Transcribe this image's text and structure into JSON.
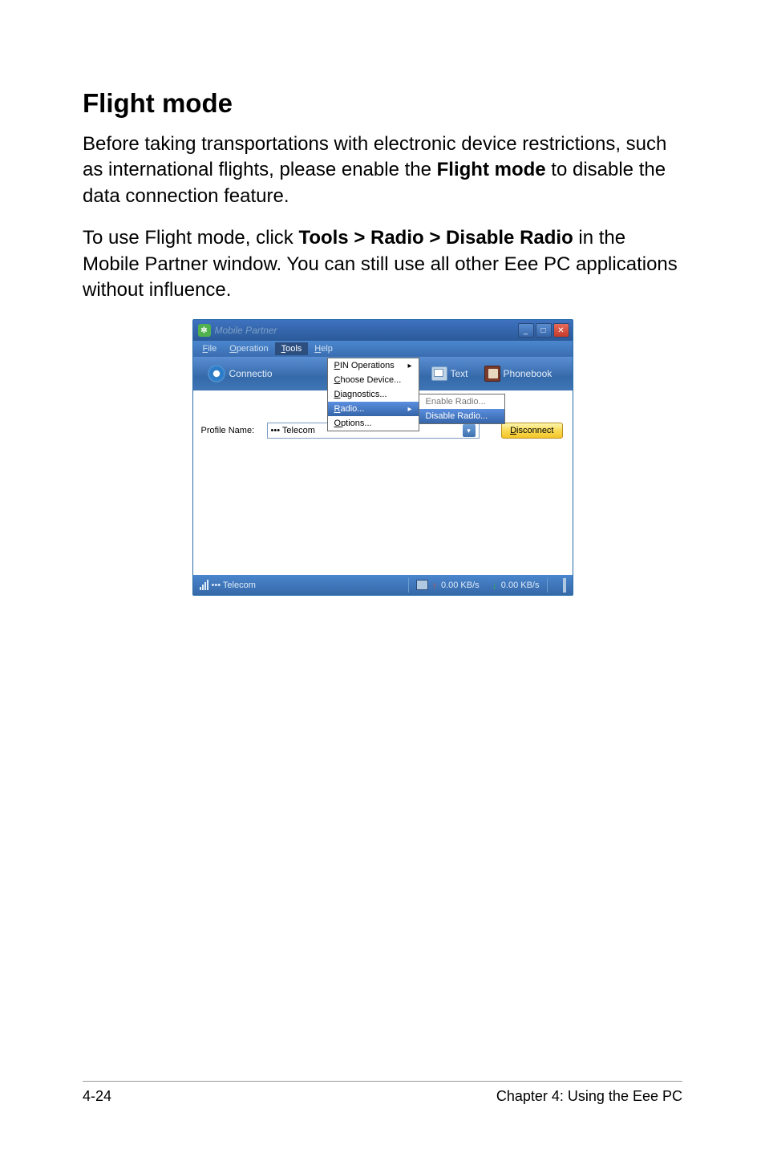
{
  "heading": "Flight mode",
  "para1_prefix": "Before taking transportations with electronic device restrictions, such as international flights, please enable the ",
  "para1_bold": "Flight mode",
  "para1_suffix": " to disable the data connection feature.",
  "para2_prefix": "To use Flight mode, click ",
  "para2_bold": "Tools > Radio > Disable Radio",
  "para2_suffix": " in the Mobile Partner window. You can still use all other Eee PC applications without influence.",
  "window": {
    "title": "Mobile Partner",
    "menus": {
      "file_key": "F",
      "file_rest": "ile",
      "op_key": "O",
      "op_rest": "peration",
      "tools_key": "T",
      "tools_rest": "ools",
      "help_key": "H",
      "help_rest": "elp"
    },
    "toolbar": {
      "connection": "Connectio",
      "text": "Text",
      "phonebook": "Phonebook"
    },
    "dropdown": {
      "pin_key": "P",
      "pin_rest": "IN Operations",
      "choose_key": "C",
      "choose_rest": "hoose Device...",
      "diag_key": "D",
      "diag_rest": "iagnostics...",
      "radio_key": "R",
      "radio_rest": "adio...",
      "options_key": "O",
      "options_rest": "ptions..."
    },
    "submenu": {
      "enable": "Enable Radio...",
      "disable": "Disable Radio..."
    },
    "body": {
      "profile_label": "Profile Name:",
      "profile_value": "••• Telecom",
      "disconnect_key": "D",
      "disconnect_rest": "isconnect"
    },
    "status": {
      "carrier": "••• Telecom",
      "up": "0.00 KB/s",
      "down": "0.00 KB/s"
    }
  },
  "footer": {
    "left": "4-24",
    "right": "Chapter 4: Using the Eee PC"
  }
}
